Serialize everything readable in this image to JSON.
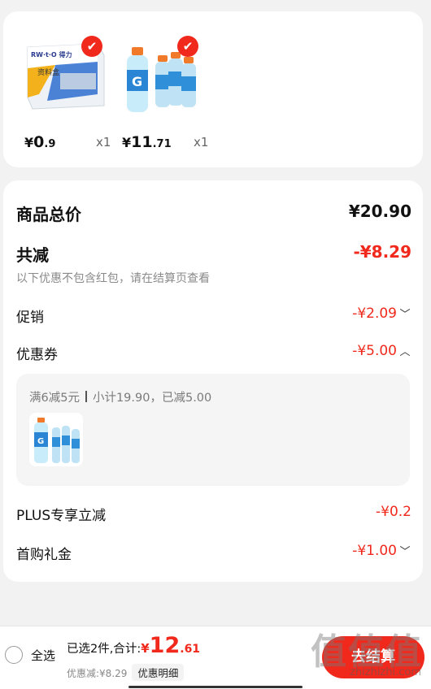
{
  "products": [
    {
      "name": "file-box-product",
      "price_symbol": "¥",
      "price_int": "0",
      "price_dec": ".9",
      "qty": "x1",
      "box_label": "资料盒",
      "check_mark": "✔"
    },
    {
      "name": "sports-drink-product",
      "price_symbol": "¥",
      "price_int": "11",
      "price_dec": ".71",
      "qty": "x1",
      "check_mark": "✔"
    }
  ],
  "summary": {
    "total_label": "商品总价",
    "total_value": "¥20.90",
    "reduce_label": "共减",
    "reduce_value": "-¥8.29",
    "note": "以下优惠不包含红包，请在结算页查看",
    "promo_label": "促销",
    "promo_value": "-¥2.09",
    "coupon_label": "优惠券",
    "coupon_value": "-¥5.00",
    "coupon_detail": {
      "rule": "满6减5元",
      "subtotal": "小计19.90，已减5.00"
    },
    "plus_label": "PLUS专享立减",
    "plus_value": "-¥0.2",
    "firstbuy_label": "首购礼金",
    "firstbuy_value": "-¥1.00"
  },
  "icons": {
    "chevron_down": "﹀",
    "chevron_up": "︿"
  },
  "bottom": {
    "select_all": "全选",
    "selected_text": "已选2件,合计:",
    "total_symbol": "¥",
    "total_int": "12",
    "total_dec": ".61",
    "discount_text": "优惠减:¥8.29",
    "detail_button": "优惠明细",
    "checkout_button": "去结算"
  },
  "watermark": {
    "text": "值值值",
    "url": "zhizhizhi.com"
  },
  "colors": {
    "accent": "#f0291c",
    "background": "#f2f2f2"
  }
}
